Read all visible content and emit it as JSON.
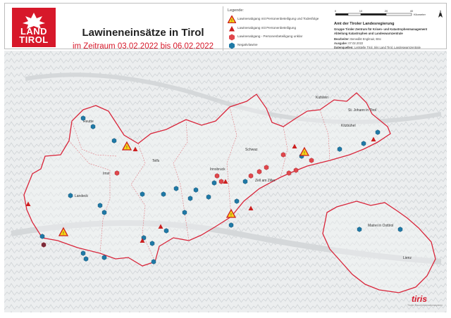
{
  "logo": {
    "line1": "LAND",
    "line2": "TIROL",
    "color": "#d7182a"
  },
  "title": "Lawineneinsätze in Tirol",
  "subtitle": "im Zeitraum 03.02.2022 bis 06.02.2022",
  "legend": {
    "title": "Legende:",
    "items": [
      {
        "label": "Lawinenabgang mit Personenbeteiligung und Todesfolge",
        "icon": "warning-triangle-icon"
      },
      {
        "label": "Lawinenabgang mit Personenbeteiligung",
        "icon": "red-triangle-icon"
      },
      {
        "label": "Lawinenabgang - Personenbeteiligung unklar",
        "icon": "red-hexagon-icon"
      },
      {
        "label": "Negativlawine",
        "icon": "blue-hexagon-icon"
      }
    ]
  },
  "scale": {
    "ticks": [
      "0",
      "10",
      "20",
      "40"
    ],
    "unit": "Kilometer"
  },
  "info": {
    "agency": "Amt der Tiroler Landesregierung",
    "group": "Gruppe Tiroler Zentrum für Krisen- und Katastrophenmanagement",
    "division": "Abteilung Katastrophen und Landeswarnzentrale",
    "editor_label": "Bearbeiter:",
    "editor": "Benedikt Englmair, BSc",
    "date_label": "Ausgabe:",
    "date": "07.02.2022",
    "sources_label": "Datenquellen:",
    "sources": "Leitstelle Tirol, tiris Land Tirol, Landeswarnzentrale"
  },
  "places": [
    "Reutte",
    "Imst",
    "Landeck",
    "Innsbruck",
    "Schwaz",
    "Kufstein",
    "Kitzbühel",
    "St. Johann in Tirol",
    "Lienz",
    "Telfs",
    "Zell am Ziller",
    "Matrei in Osttirol"
  ],
  "colors": {
    "triangle_red": "#cc1f1f",
    "hex_red": "#e0474c",
    "hex_blue": "#1f79a6",
    "warning_yellow": "#f7d417",
    "border": "#d9253a"
  },
  "branding": {
    "text": "tiris",
    "sub": "Tiroler Rauminformationssystem"
  }
}
